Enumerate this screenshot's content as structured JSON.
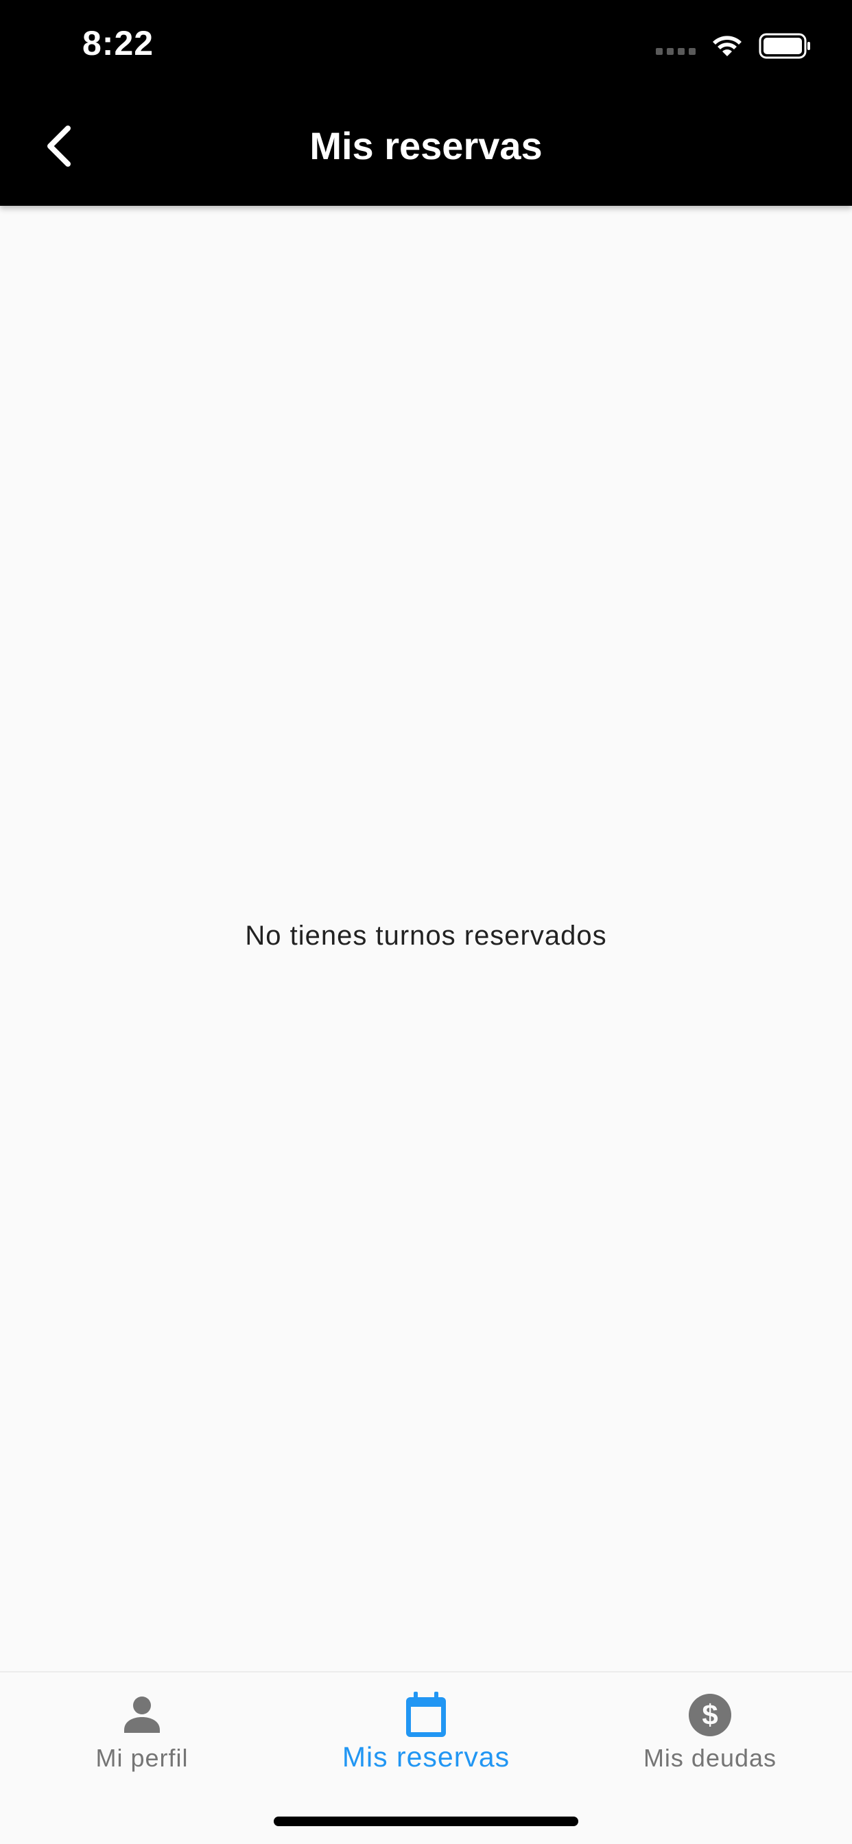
{
  "status_bar": {
    "time": "8:22"
  },
  "app_bar": {
    "title": "Mis reservas",
    "back_icon": "chevron-left-icon"
  },
  "main": {
    "empty_message": "No tienes turnos reservados"
  },
  "bottom_nav": {
    "items": [
      {
        "label": "Mi perfil",
        "icon": "person-icon",
        "active": false
      },
      {
        "label": "Mis reservas",
        "icon": "calendar-icon",
        "active": true
      },
      {
        "label": "Mis deudas",
        "icon": "dollar-icon",
        "active": false
      }
    ]
  },
  "colors": {
    "header_background": "#000000",
    "page_background": "#fafafa",
    "active_accent": "#2196f3",
    "inactive": "#757575"
  }
}
